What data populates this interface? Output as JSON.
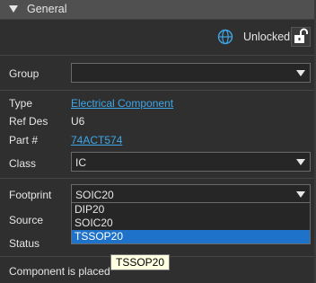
{
  "header": {
    "title": "General"
  },
  "lock": {
    "status_label": "Unlocked"
  },
  "fields": {
    "group": {
      "label": "Group",
      "value": ""
    },
    "type": {
      "label": "Type",
      "value": "Electrical Component"
    },
    "ref_des": {
      "label": "Ref Des",
      "value": "U6"
    },
    "part_number": {
      "label": "Part #",
      "value": "74ACT574"
    },
    "class": {
      "label": "Class",
      "value": "IC"
    },
    "footprint": {
      "label": "Footprint",
      "value": "SOIC20",
      "options": [
        "DIP20",
        "SOIC20",
        "TSSOP20"
      ],
      "highlighted": "TSSOP20"
    },
    "source": {
      "label": "Source"
    },
    "status": {
      "label": "Status"
    }
  },
  "placement": {
    "text": "Component is placed"
  },
  "tooltip": {
    "text": "TSSOP20"
  },
  "colors": {
    "background": "#2f2f2f",
    "header": "#505050",
    "link": "#3ea7e8",
    "selection": "#1f72c9",
    "tooltip_bg": "#ffffe1"
  }
}
